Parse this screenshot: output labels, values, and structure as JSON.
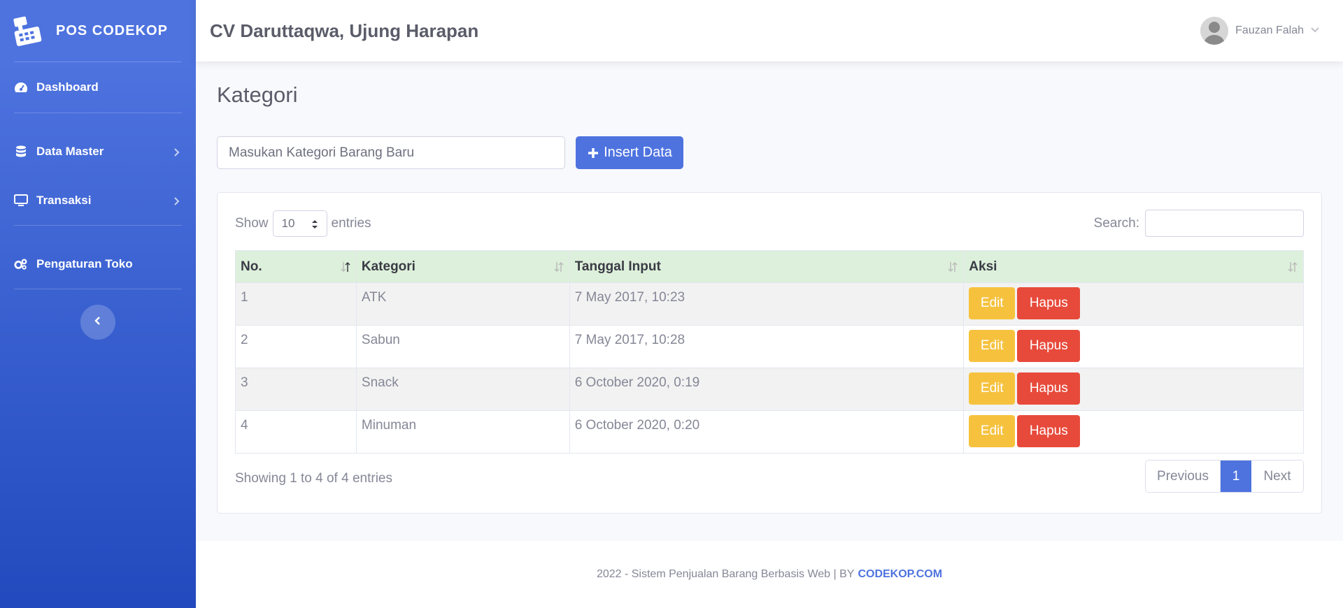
{
  "sidebar": {
    "brand": "POS CODEKOP",
    "items": [
      {
        "label": "Dashboard",
        "icon": "tachometer-icon"
      },
      {
        "label": "Data Master",
        "icon": "database-icon"
      },
      {
        "label": "Transaksi",
        "icon": "desktop-icon"
      },
      {
        "label": "Pengaturan Toko",
        "icon": "cogs-icon"
      }
    ]
  },
  "topbar": {
    "company": "CV Daruttaqwa, Ujung Harapan",
    "user_name": "Fauzan Falah"
  },
  "page": {
    "title": "Kategori",
    "new_category_placeholder": "Masukan Kategori Barang Baru",
    "insert_label": "Insert Data"
  },
  "table_controls": {
    "show_prefix": "Show",
    "show_value": "10",
    "show_suffix": "entries",
    "search_label": "Search:"
  },
  "table": {
    "headers": [
      "No.",
      "Kategori",
      "Tanggal Input",
      "Aksi"
    ],
    "rows": [
      {
        "no": "1",
        "kategori": "ATK",
        "tanggal": "7 May 2017, 10:23"
      },
      {
        "no": "2",
        "kategori": "Sabun",
        "tanggal": "7 May 2017, 10:28"
      },
      {
        "no": "3",
        "kategori": "Snack",
        "tanggal": "6 October 2020, 0:19"
      },
      {
        "no": "4",
        "kategori": "Minuman",
        "tanggal": "6 October 2020, 0:20"
      }
    ],
    "edit_label": "Edit",
    "delete_label": "Hapus"
  },
  "pagination": {
    "info": "Showing 1 to 4 of 4 entries",
    "previous": "Previous",
    "current": "1",
    "next": "Next"
  },
  "footer": {
    "text": "2022 - Sistem Penjualan Barang Berbasis Web | BY",
    "link": "CODEKOP.COM"
  },
  "colors": {
    "primary": "#4e73df",
    "warning": "#f6c23e",
    "danger": "#e74a3b",
    "header_row": "#ddf0db"
  }
}
